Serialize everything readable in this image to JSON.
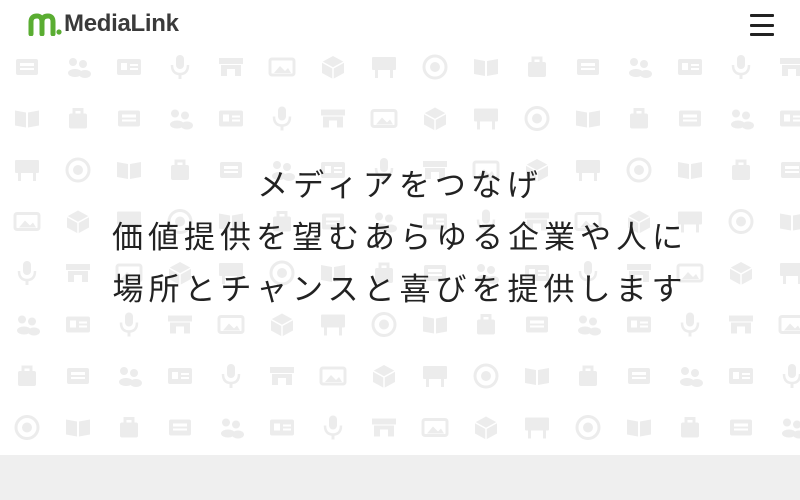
{
  "header": {
    "logo_text": "MediaLink",
    "logo_mark_icon": "medialink-m-mark-icon",
    "menu_icon": "hamburger-menu-icon"
  },
  "hero": {
    "lines": [
      "メディアをつなげ",
      "価値提供を望むあらゆる企業や人に",
      "場所とチャンスと喜びを提供します"
    ]
  },
  "background_pattern": {
    "icon_color": "#ececec",
    "icons": [
      "newspaper-icon",
      "shop-icon",
      "money-cycle-icon",
      "people-icon",
      "image-icon",
      "book-icon",
      "id-card-icon",
      "box-icon",
      "bag-icon",
      "microphone-icon",
      "billboard-icon"
    ]
  },
  "colors": {
    "brand_green": "#5aad32",
    "text_dark": "#222222",
    "logo_text": "#3a3a3a",
    "footer_bg": "#efefef"
  }
}
